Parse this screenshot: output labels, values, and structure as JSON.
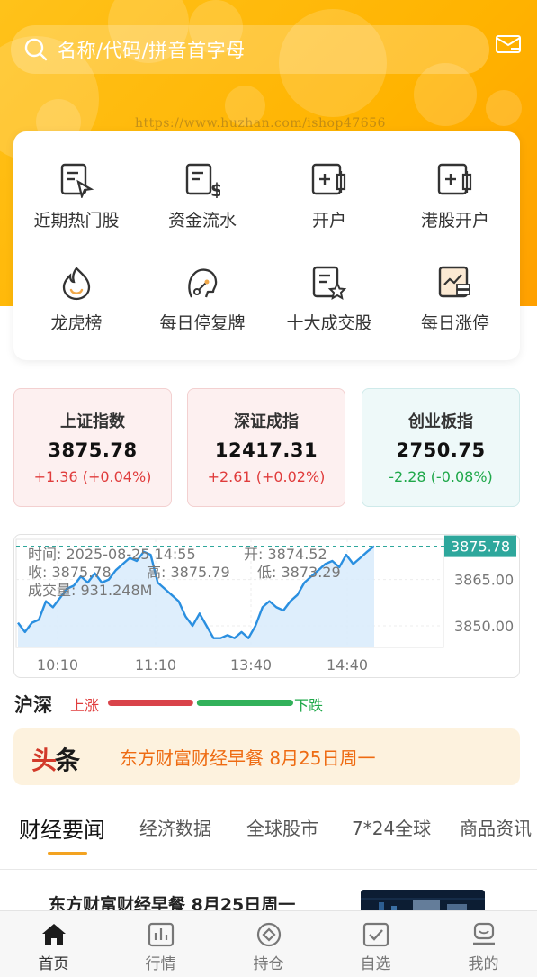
{
  "search": {
    "placeholder": "名称/代码/拼音首字母"
  },
  "watermark": "https://www.huzhan.com/ishop47656",
  "menu": [
    {
      "label": "近期热门股",
      "icon": "hot-stock-icon"
    },
    {
      "label": "资金流水",
      "icon": "fund-flow-icon"
    },
    {
      "label": "开户",
      "icon": "open-account-icon"
    },
    {
      "label": "港股开户",
      "icon": "hk-account-icon"
    },
    {
      "label": "龙虎榜",
      "icon": "dragon-tiger-icon"
    },
    {
      "label": "每日停复牌",
      "icon": "suspension-icon"
    },
    {
      "label": "十大成交股",
      "icon": "top-volume-icon"
    },
    {
      "label": "每日涨停",
      "icon": "limit-up-icon"
    }
  ],
  "indices": [
    {
      "name": "上证指数",
      "value": "3875.78",
      "change": "+1.36 (+0.04%)",
      "trend": "up"
    },
    {
      "name": "深证成指",
      "value": "12417.31",
      "change": "+2.61 (+0.02%)",
      "trend": "up"
    },
    {
      "name": "创业板指",
      "value": "2750.75",
      "change": "-2.28 (-0.08%)",
      "trend": "down"
    }
  ],
  "chart_info": {
    "time": "时间: 2025-08-25 14:55",
    "open": "开: 3874.52",
    "close": "收: 3875.78",
    "high": "高: 3875.79",
    "low": "低: 3873.29",
    "volume": "成交量: 931.248M"
  },
  "chart_data": {
    "type": "area",
    "x_ticks": [
      "10:10",
      "11:10",
      "13:40",
      "14:40"
    ],
    "y_ticks": [
      "3865.00",
      "3850.00"
    ],
    "last_price": "3875.78",
    "ylim": [
      3843,
      3878
    ],
    "values": [
      3851,
      3848,
      3851,
      3852,
      3858,
      3856,
      3859,
      3862,
      3863,
      3866,
      3864,
      3867,
      3864,
      3865,
      3868,
      3870,
      3872,
      3871,
      3874,
      3873,
      3864,
      3862,
      3860,
      3858,
      3853,
      3850,
      3854,
      3850,
      3846,
      3846,
      3847,
      3846,
      3848,
      3846,
      3850,
      3856,
      3858,
      3856,
      3855,
      3858,
      3860,
      3864,
      3866,
      3868,
      3870,
      3871,
      3869,
      3873,
      3870,
      3872,
      3874,
      3875.78
    ],
    "colors": {
      "line": "#2a8fe0",
      "fill": "#d8ebfb",
      "ref": "#2ea79c"
    }
  },
  "updown": {
    "title": "沪深",
    "up": "上涨",
    "down": "下跌",
    "up_ratio": 0.47,
    "colors": {
      "up": "#d9434a",
      "down": "#32b15a"
    }
  },
  "headline": {
    "logo_a": "头",
    "logo_b": "条",
    "text": "东方财富财经早餐 8月25日周一"
  },
  "tabs": [
    "财经要闻",
    "经济数据",
    "全球股市",
    "7*24全球",
    "商品资讯"
  ],
  "news": [
    {
      "title": "东方财富财经早餐 8月25日周一"
    }
  ],
  "bottom_nav": [
    {
      "label": "首页",
      "icon": "home-icon"
    },
    {
      "label": "行情",
      "icon": "market-icon"
    },
    {
      "label": "持仓",
      "icon": "position-icon"
    },
    {
      "label": "自选",
      "icon": "watchlist-icon"
    },
    {
      "label": "我的",
      "icon": "profile-icon"
    }
  ]
}
